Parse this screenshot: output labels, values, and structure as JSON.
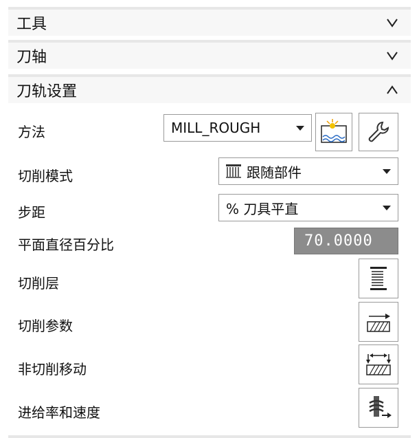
{
  "sections": {
    "tools": {
      "title": "工具"
    },
    "axis": {
      "title": "刀轴"
    },
    "path": {
      "title": "刀轨设置"
    }
  },
  "path_settings": {
    "method": {
      "label": "方法",
      "value": "MILL_ROUGH"
    },
    "cut_pattern": {
      "label": "切削模式",
      "value": "跟随部件"
    },
    "stepover": {
      "label": "步距",
      "value": "% 刀具平直"
    },
    "flat_diameter": {
      "label": "平面直径百分比",
      "value": "70.0000"
    },
    "cut_levels": {
      "label": "切削层"
    },
    "cut_params": {
      "label": "切削参数"
    },
    "non_cut_moves": {
      "label": "非切削移动"
    },
    "feeds_speeds": {
      "label": "进给率和速度"
    }
  }
}
